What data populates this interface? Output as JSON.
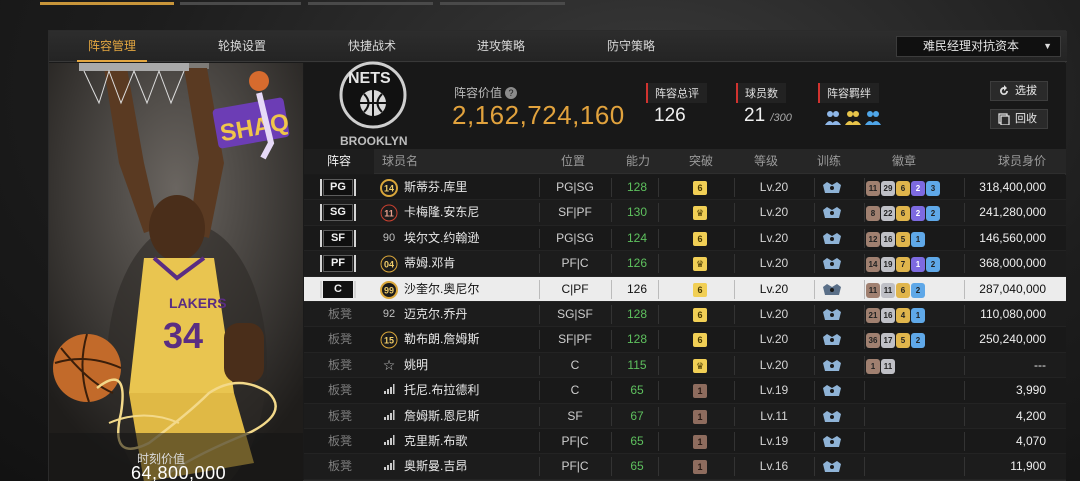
{
  "colors": {
    "accent": "#e3a640",
    "ability_green": "#5ec05e",
    "stat_red": "#d1332f"
  },
  "tabs": [
    {
      "label": "阵容管理",
      "active": true
    },
    {
      "label": "轮换设置",
      "active": false
    },
    {
      "label": "快捷战术",
      "active": false
    },
    {
      "label": "进攻策略",
      "active": false
    },
    {
      "label": "防守策略",
      "active": false
    }
  ],
  "dropdown": {
    "value": "难民经理对抗资本"
  },
  "card": {
    "number": "34",
    "value_label": "时刻价值",
    "value": "64,800,000"
  },
  "header": {
    "value_label": "阵容价值",
    "value": "2,162,724,160",
    "overall_label": "阵容总评",
    "overall_value": "126",
    "players_label": "球员数",
    "players_value": "21",
    "players_max": "/300",
    "synergy_label": "阵容羁绊",
    "select_button": "选拔",
    "recycle_button": "回收"
  },
  "table": {
    "headers": {
      "lineup": "阵容",
      "name": "球员名",
      "position": "位置",
      "ability": "能力",
      "breakthrough": "突破",
      "level": "等级",
      "training": "训练",
      "badges": "徽章",
      "salary": "球员身价"
    },
    "rows": [
      {
        "slot": "PG",
        "starter": true,
        "number": "14",
        "number_style": "gold",
        "name": "斯蒂芬.库里",
        "position": "PG|SG",
        "ability": "128",
        "bt": "6",
        "bt_style": "gold",
        "level": "Lv.20",
        "badges": [
          [
            "11",
            "bronze"
          ],
          [
            "29",
            "silver"
          ],
          [
            "6",
            "gold"
          ],
          [
            "2",
            "purple"
          ],
          [
            "3",
            "blue"
          ]
        ],
        "salary": "318,400,000"
      },
      {
        "slot": "SG",
        "starter": true,
        "number": "11",
        "number_style": "red",
        "name": "卡梅隆.安东尼",
        "position": "SF|PF",
        "ability": "130",
        "bt": "♛",
        "bt_style": "gold",
        "level": "Lv.20",
        "badges": [
          [
            "8",
            "bronze"
          ],
          [
            "22",
            "silver"
          ],
          [
            "6",
            "gold"
          ],
          [
            "2",
            "purple"
          ],
          [
            "2",
            "blue"
          ]
        ],
        "salary": "241,280,000"
      },
      {
        "slot": "SF",
        "starter": true,
        "number": "90",
        "number_style": "plain",
        "name": "埃尔文.约翰逊",
        "position": "PG|SG",
        "ability": "124",
        "bt": "6",
        "bt_style": "gold",
        "level": "Lv.20",
        "badges": [
          [
            "12",
            "bronze"
          ],
          [
            "16",
            "silver"
          ],
          [
            "5",
            "gold"
          ],
          [
            "1",
            "blue"
          ]
        ],
        "salary": "146,560,000"
      },
      {
        "slot": "PF",
        "starter": true,
        "number": "04",
        "number_style": "gold-text",
        "name": "蒂姆.邓肯",
        "position": "PF|C",
        "ability": "126",
        "bt": "♛",
        "bt_style": "gold",
        "level": "Lv.20",
        "badges": [
          [
            "14",
            "bronze"
          ],
          [
            "19",
            "silver"
          ],
          [
            "7",
            "gold"
          ],
          [
            "1",
            "purple"
          ],
          [
            "2",
            "blue"
          ]
        ],
        "salary": "368,000,000"
      },
      {
        "slot": "C",
        "starter": true,
        "selected": true,
        "number": "99",
        "number_style": "gold",
        "name": "沙奎尔.奥尼尔",
        "position": "C|PF",
        "ability": "126",
        "bt": "6",
        "bt_style": "gold",
        "level": "Lv.20",
        "badges": [
          [
            "11",
            "bronze"
          ],
          [
            "11",
            "silver"
          ],
          [
            "6",
            "gold"
          ],
          [
            "2",
            "blue"
          ]
        ],
        "salary": "287,040,000"
      },
      {
        "slot": "板凳",
        "starter": false,
        "number": "92",
        "number_style": "plain",
        "name": "迈克尔.乔丹",
        "position": "SG|SF",
        "ability": "128",
        "bt": "6",
        "bt_style": "gold",
        "level": "Lv.20",
        "badges": [
          [
            "21",
            "bronze"
          ],
          [
            "16",
            "silver"
          ],
          [
            "4",
            "gold"
          ],
          [
            "1",
            "blue"
          ]
        ],
        "salary": "110,080,000"
      },
      {
        "slot": "板凳",
        "starter": false,
        "number": "15",
        "number_style": "gold-text",
        "name": "勒布朗.詹姆斯",
        "position": "SF|PF",
        "ability": "128",
        "bt": "6",
        "bt_style": "gold",
        "level": "Lv.20",
        "badges": [
          [
            "36",
            "bronze"
          ],
          [
            "17",
            "silver"
          ],
          [
            "5",
            "gold"
          ],
          [
            "2",
            "blue"
          ]
        ],
        "salary": "250,240,000"
      },
      {
        "slot": "板凳",
        "starter": false,
        "number": "",
        "number_style": "star",
        "name": "姚明",
        "position": "C",
        "ability": "115",
        "bt": "♛",
        "bt_style": "gold",
        "level": "Lv.20",
        "badges": [
          [
            "1",
            "bronze"
          ],
          [
            "11",
            "silver"
          ]
        ],
        "salary": "---"
      },
      {
        "slot": "板凳",
        "starter": false,
        "number": "",
        "number_style": "bars",
        "name": "托尼.布拉德利",
        "position": "C",
        "ability": "65",
        "bt": "1",
        "bt_style": "brown",
        "level": "Lv.19",
        "badges": [],
        "salary": "3,990"
      },
      {
        "slot": "板凳",
        "starter": false,
        "number": "",
        "number_style": "bars",
        "name": "詹姆斯.恩尼斯",
        "position": "SF",
        "ability": "67",
        "bt": "1",
        "bt_style": "brown",
        "level": "Lv.11",
        "badges": [],
        "salary": "4,200"
      },
      {
        "slot": "板凳",
        "starter": false,
        "number": "",
        "number_style": "bars",
        "name": "克里斯.布歌",
        "position": "PF|C",
        "ability": "65",
        "bt": "1",
        "bt_style": "brown",
        "level": "Lv.19",
        "badges": [],
        "salary": "4,070"
      },
      {
        "slot": "板凳",
        "starter": false,
        "number": "",
        "number_style": "bars",
        "name": "奥斯曼.吉昂",
        "position": "PF|C",
        "ability": "65",
        "bt": "1",
        "bt_style": "brown",
        "level": "Lv.16",
        "badges": [],
        "salary": "11,900"
      }
    ]
  }
}
